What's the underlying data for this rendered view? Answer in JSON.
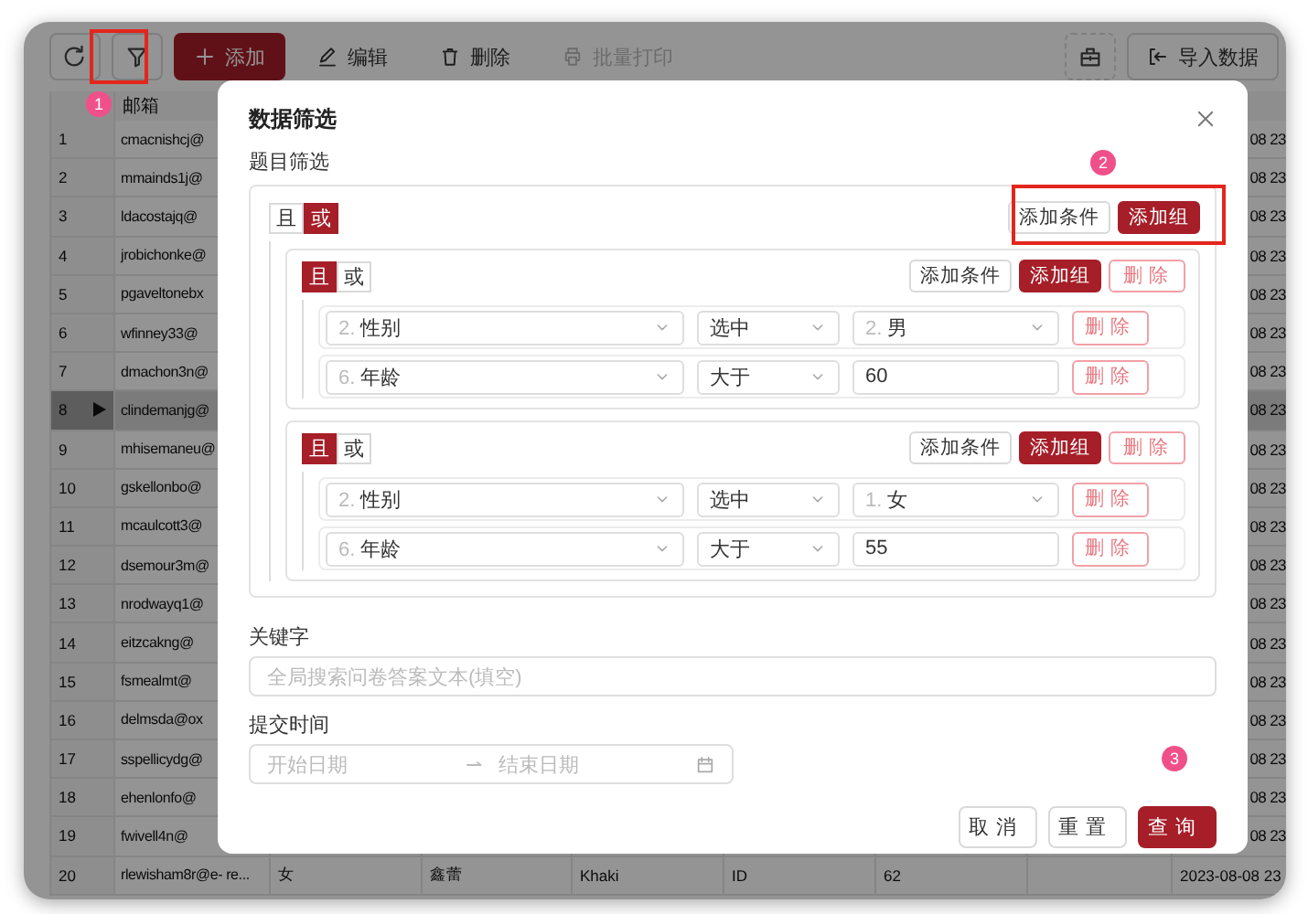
{
  "toolbar": {
    "buttons": [
      {
        "kind": "icon",
        "disabled": false
      },
      {
        "kind": "icon",
        "disabled": false
      },
      {
        "kind": "primary",
        "label": "添加",
        "disabled": false
      },
      {
        "kind": "text",
        "label": "编辑",
        "disabled": false
      },
      {
        "kind": "text",
        "label": "删除",
        "disabled": false
      },
      {
        "kind": "text",
        "label": "批量打印",
        "disabled": true
      }
    ],
    "right": [
      {
        "kind": "icon"
      },
      {
        "kind": "outline",
        "label": "导入数据"
      }
    ]
  },
  "table": {
    "columns": [
      {
        "label": "邮箱"
      }
    ],
    "rows": [
      {
        "kind": "covered",
        "index": "1",
        "email": "cmacnishcj@",
        "column_9": "08 23",
        "selected": false
      },
      {
        "kind": "covered",
        "index": "2",
        "email": "mmainds1j@",
        "column_9": "08 23",
        "selected": false
      },
      {
        "kind": "covered",
        "index": "3",
        "email": "ldacostajq@",
        "column_9": "08 23",
        "selected": false
      },
      {
        "kind": "covered",
        "index": "4",
        "email": "jrobichonke@",
        "column_9": "08 23",
        "selected": false
      },
      {
        "kind": "covered",
        "index": "5",
        "email": "pgaveltonebx",
        "column_9": "08 23",
        "selected": false
      },
      {
        "kind": "covered",
        "index": "6",
        "email": "wfinney33@",
        "column_9": "08 23",
        "selected": false
      },
      {
        "kind": "covered",
        "index": "7",
        "email": "dmachon3n@",
        "column_9": "08 23",
        "selected": false
      },
      {
        "kind": "covered",
        "index": "8",
        "email": "clindemanjg@",
        "column_9": "08 23",
        "selected": true
      },
      {
        "kind": "covered",
        "index": "9",
        "email": "mhisemaneu@",
        "column_9": "08 23",
        "selected": false
      },
      {
        "kind": "covered",
        "index": "10",
        "email": "gskellonbo@",
        "column_9": "08 23",
        "selected": false
      },
      {
        "kind": "covered",
        "index": "11",
        "email": "mcaulcott3@",
        "column_9": "08 23",
        "selected": false
      },
      {
        "kind": "covered",
        "index": "12",
        "email": "dsemour3m@",
        "column_9": "08 23",
        "selected": false
      },
      {
        "kind": "covered",
        "index": "13",
        "email": "nrodwayq1@",
        "column_9": "08 23",
        "selected": false
      },
      {
        "kind": "covered",
        "index": "14",
        "email": "eitzcakng@",
        "column_9": "08 23",
        "selected": false
      },
      {
        "kind": "covered",
        "index": "15",
        "email": "fsmealmt@",
        "column_9": "08 23",
        "selected": false
      },
      {
        "kind": "covered",
        "index": "16",
        "email": "delmsda@ox",
        "column_9": "08 23",
        "selected": false
      },
      {
        "kind": "covered",
        "index": "17",
        "email": "sspellicydg@",
        "column_9": "08 23",
        "selected": false
      },
      {
        "kind": "covered",
        "index": "18",
        "email": "ehenlonfo@",
        "column_9": "08 23",
        "selected": false
      },
      {
        "kind": "covered",
        "index": "19",
        "email": "fwivell4n@",
        "column_9": "08 23",
        "selected": false
      },
      {
        "kind": "full",
        "index": "20",
        "email": "rlewisham8r@e- re...",
        "column_3": "女",
        "column_4": "鑫蕾",
        "column_5": "Khaki",
        "column_6": "ID",
        "column_7": "62",
        "column_9": "2023-08-08 23",
        "selected": false
      }
    ]
  },
  "dialog": {
    "title": "数据筛选",
    "section_label": "题目筛选",
    "filter": {
      "logic": [
        {
          "label": "且",
          "selected": false
        },
        {
          "label": "或",
          "selected": true
        }
      ],
      "actions": [
        {
          "kind": "default",
          "label": "添加条件"
        },
        {
          "kind": "primary",
          "label": "添加组"
        }
      ],
      "groups": [
        {
          "logic": [
            {
              "label": "且",
              "selected": true
            },
            {
              "label": "或",
              "selected": false
            }
          ],
          "actions": [
            {
              "kind": "default",
              "label": "添加条件"
            },
            {
              "kind": "primary",
              "label": "添加组"
            },
            {
              "kind": "danger",
              "label": "删除"
            }
          ],
          "conditions": [
            {
              "field_index": "2.",
              "field": "性别",
              "operator": "选中",
              "kind": "select",
              "value_index": "2.",
              "value": "男",
              "delete_label": "删除"
            },
            {
              "field_index": "6.",
              "field": "年龄",
              "operator": "大于",
              "kind": "input",
              "value": "60",
              "delete_label": "删除"
            }
          ]
        },
        {
          "logic": [
            {
              "label": "且",
              "selected": true
            },
            {
              "label": "或",
              "selected": false
            }
          ],
          "actions": [
            {
              "kind": "default",
              "label": "添加条件"
            },
            {
              "kind": "primary",
              "label": "添加组"
            },
            {
              "kind": "danger",
              "label": "删除"
            }
          ],
          "conditions": [
            {
              "field_index": "2.",
              "field": "性别",
              "operator": "选中",
              "kind": "select",
              "value_index": "1.",
              "value": "女",
              "delete_label": "删除"
            },
            {
              "field_index": "6.",
              "field": "年龄",
              "operator": "大于",
              "kind": "input",
              "value": "55",
              "delete_label": "删除"
            }
          ]
        }
      ]
    },
    "keyword": {
      "label": "关键字",
      "placeholder": "全局搜索问卷答案文本(填空)"
    },
    "submit_time": {
      "label": "提交时间",
      "start_placeholder": "开始日期",
      "end_placeholder": "结束日期"
    },
    "footer": [
      {
        "kind": "default",
        "label": "取消"
      },
      {
        "kind": "default",
        "label": "重置"
      },
      {
        "kind": "primary",
        "label": "查询"
      }
    ]
  },
  "annotations": [
    {
      "number": "1"
    },
    {
      "number": "2"
    },
    {
      "number": "3"
    }
  ]
}
